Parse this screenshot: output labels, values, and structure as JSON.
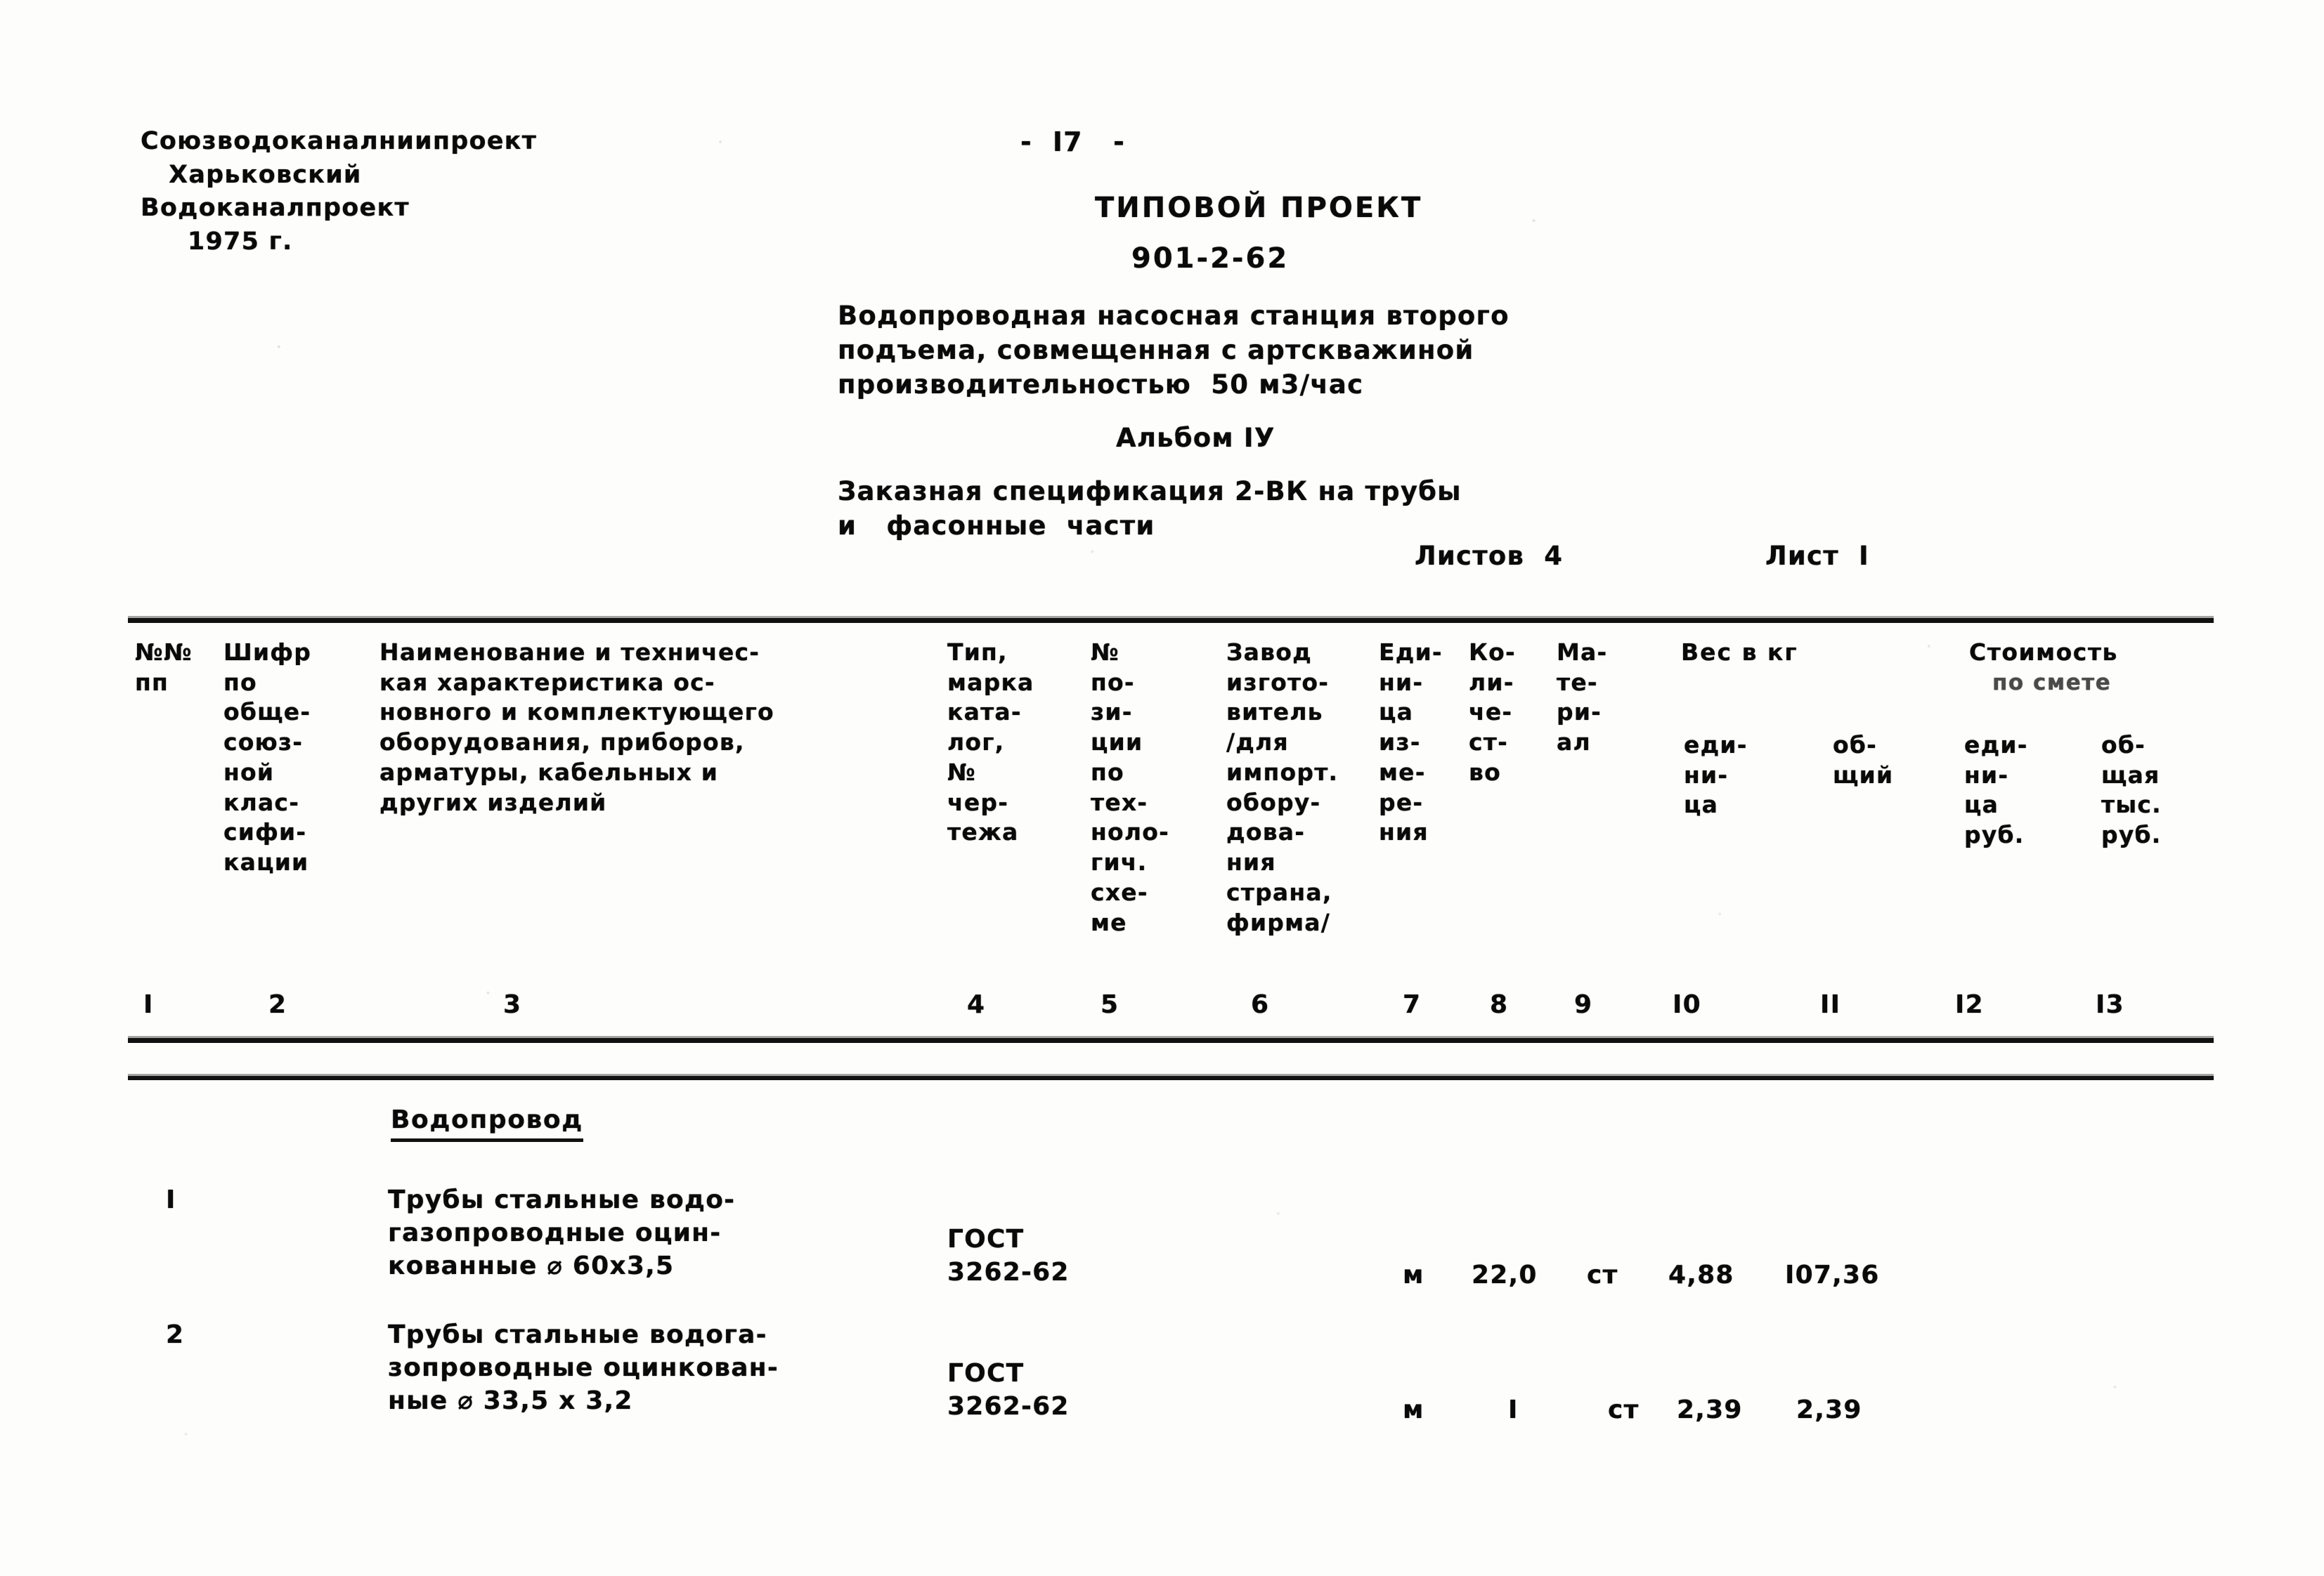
{
  "masthead": {
    "organization": "Союзводоканалниипроект\n   Харьковский\nВодоканалпроект\n     1975 г.",
    "page_number": "-  I7   -",
    "doc_type": "ТИПОВОЙ ПРОЕКТ",
    "doc_code": "901-2-62",
    "description": "Водопроводная насосная станция второго\nподъема, совмещенная с артскважиной\nпроизводительностью  50 м3/час",
    "album": "Альбом IУ",
    "spec_title": "Заказная спецификация 2-ВК на трубы\nи   фасонные  части",
    "sheets_total": "Листов  4",
    "sheet_current": "Лист  I"
  },
  "table": {
    "headers": {
      "col1": "№№\nпп",
      "col2": "Шифр\nпо\nобще-\nсоюз-\nной\nклас-\nсифи-\nкации",
      "col3": "Наименование и техничес-\nкая характеристика ос-\nновного и комплектующего\nоборудования, приборов,\nарматуры, кабельных и\nдругих изделий",
      "col4": "Тип,\nмарка\nката-\nлог,\n№\nчер-\nтежа",
      "col5": "№\nпо-\nзи-\nции\nпо\nтех-\nноло-\nгич.\nсхе-\nме",
      "col6": "Завод\nизгото-\nвитель\n/для\nимпорт.\nобору-\nдова-\nния\nстрана,\nфирма/",
      "col7": "Еди-\nни-\nца\nиз-\nме-\nре-\nния",
      "col8": "Ко-\nли-\nче-\nст-\nво",
      "col9": "Ма-\nте-\nри-\nал",
      "weight_group": "Вес в кг",
      "cost_group": "Стоимость",
      "cost_group_sub": "по смете",
      "col10": "еди-\nни-\nца",
      "col11": "об-\nщий",
      "col12": "еди-\nни-\nца\nруб.",
      "col13": "об-\nщая\nтыс.\nруб."
    },
    "column_numbers": [
      "I",
      "2",
      "3",
      "4",
      "5",
      "6",
      "7",
      "8",
      "9",
      "I0",
      "II",
      "I2",
      "I3"
    ],
    "section_heading": "Водопровод",
    "rows": [
      {
        "num": "I",
        "description": "Трубы стальные водо-\nгазопроводные оцин-\nкованные ⌀ 60х3,5",
        "gost": "ГОСТ\n3262-62",
        "position": "",
        "manufacturer": "",
        "unit": "м",
        "quantity": "22,0",
        "material": "ст",
        "weight_unit": "4,88",
        "weight_total": "I07,36",
        "cost_unit": "",
        "cost_total": ""
      },
      {
        "num": "2",
        "description": "Трубы стальные водога-\nзопроводные оцинкован-\nные ⌀ 33,5 х 3,2",
        "gost": "ГОСТ\n3262-62",
        "position": "",
        "manufacturer": "",
        "unit": "м",
        "quantity": "I",
        "material": "ст",
        "weight_unit": "2,39",
        "weight_total": "2,39",
        "cost_unit": "",
        "cost_total": ""
      }
    ]
  }
}
